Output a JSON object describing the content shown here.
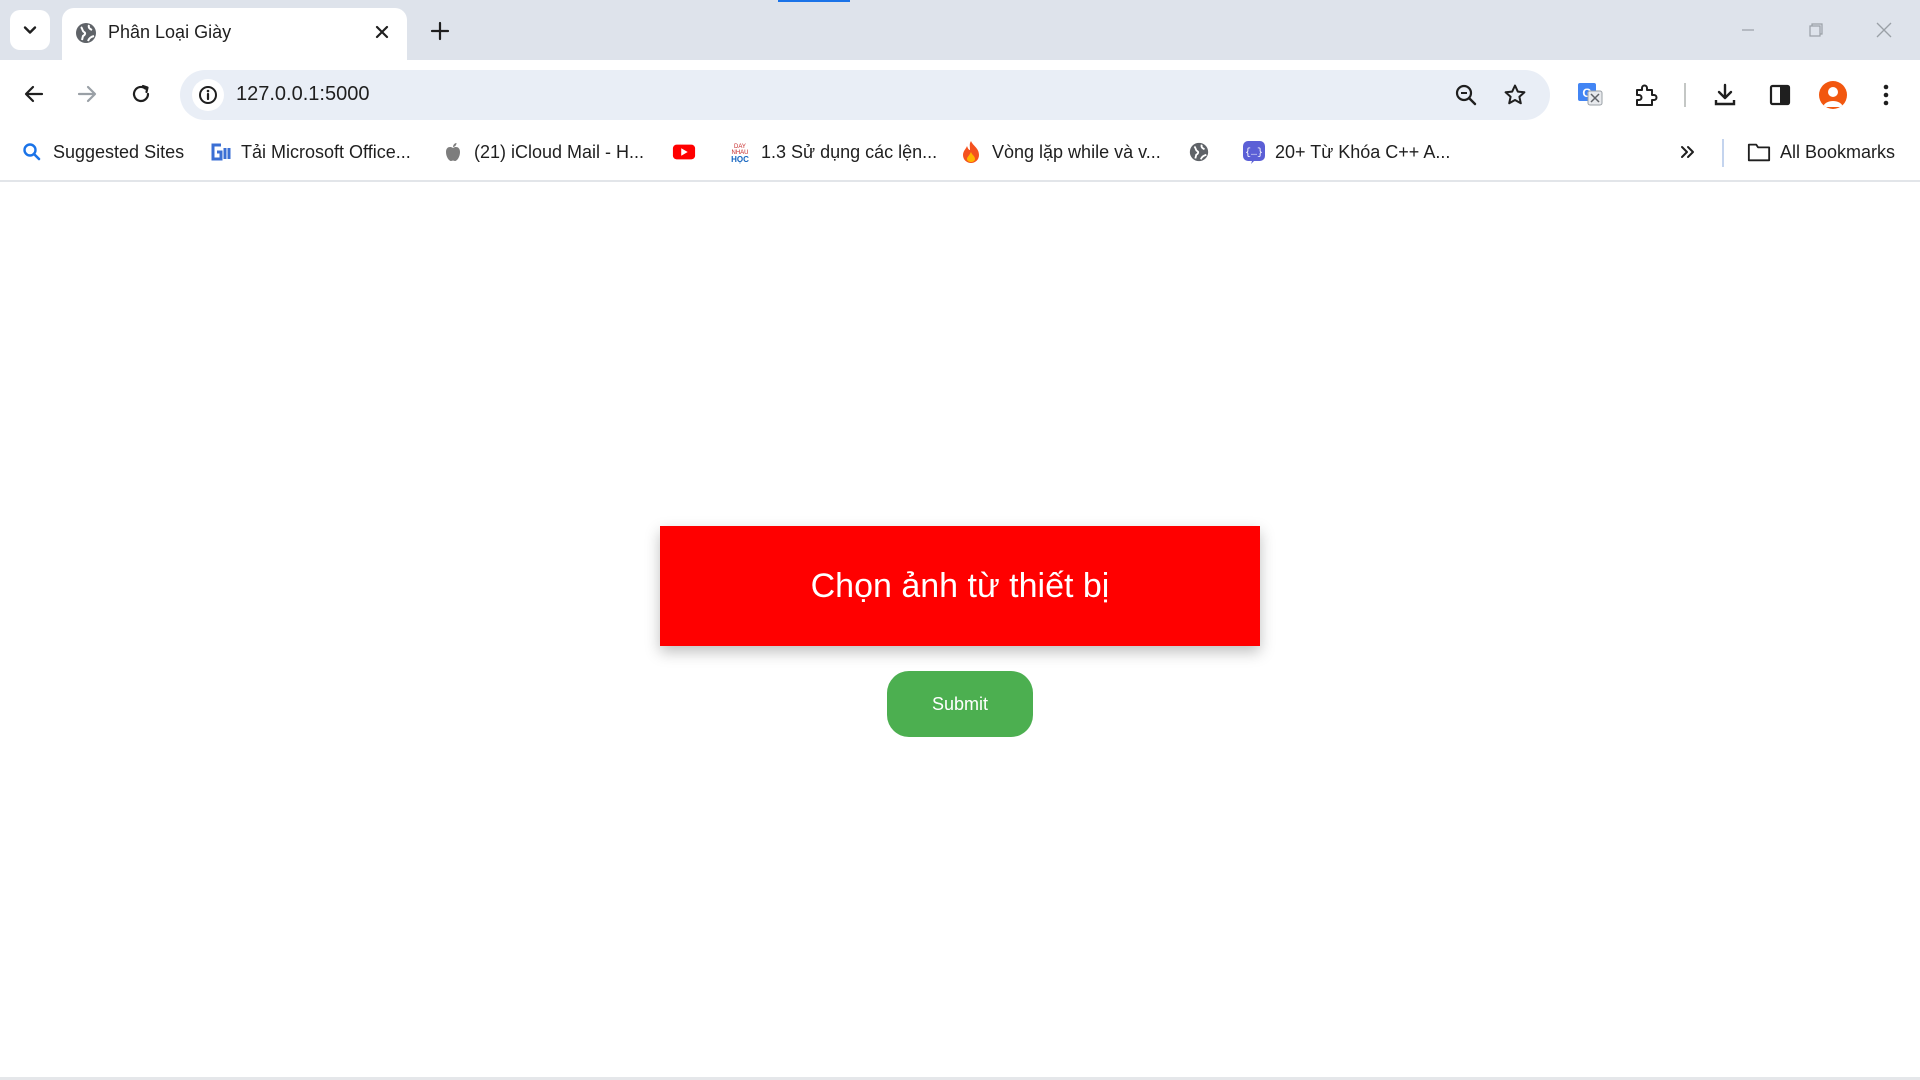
{
  "window": {
    "tab_title": "Phân Loại Giày"
  },
  "toolbar": {
    "url": "127.0.0.1:5000"
  },
  "bookmarks": {
    "items": [
      {
        "label": "Suggested Sites",
        "icon": "search-icon"
      },
      {
        "label": "Tải Microsoft Office...",
        "icon": "gi-logo-icon"
      },
      {
        "label": "(21) iCloud Mail - H...",
        "icon": "apple-icon"
      },
      {
        "label": "",
        "icon": "youtube-icon"
      },
      {
        "label": "1.3 Sử dụng các lện...",
        "icon": "dayhoc-icon"
      },
      {
        "label": "Vòng lặp while và v...",
        "icon": "fire-icon"
      },
      {
        "label": "",
        "icon": "globe-icon"
      },
      {
        "label": "20+ Từ Khóa C++ A...",
        "icon": "code-braces-icon"
      }
    ],
    "all_bookmarks_label": "All Bookmarks"
  },
  "page": {
    "choose_image_label": "Chọn ảnh từ thiết bị",
    "submit_label": "Submit"
  },
  "colors": {
    "choose_button": "#ff0000",
    "submit_button": "#4caf50",
    "tabstrip": "#dee3eb",
    "omnibox": "#e9eef6",
    "accent": "#1a73e8"
  }
}
